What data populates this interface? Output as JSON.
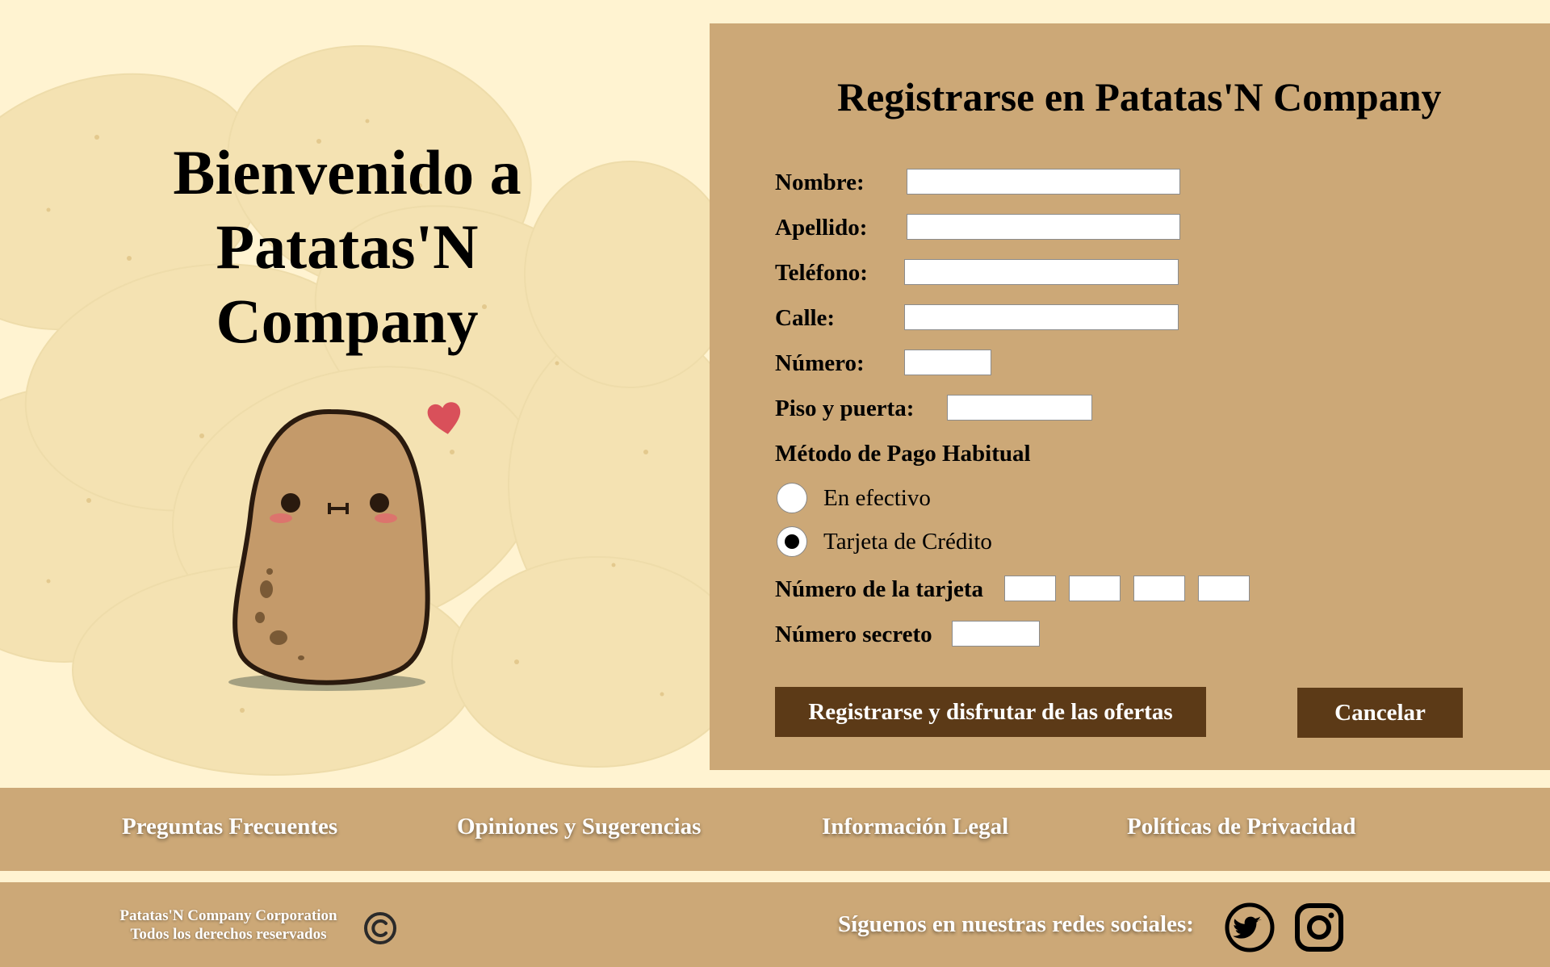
{
  "hero": {
    "welcome_line1": "Bienvenido a",
    "welcome_line2": "Patatas'N",
    "welcome_line3": "Company",
    "mascot_icon": "potato-mascot-icon",
    "heart_icon": "heart-icon"
  },
  "form": {
    "title": "Registrarse en Patatas'N Company",
    "nombre_label": "Nombre:",
    "nombre_value": "",
    "apellido_label": "Apellido:",
    "apellido_value": "",
    "telefono_label": "Teléfono:",
    "telefono_value": "",
    "calle_label": "Calle:",
    "calle_value": "",
    "numero_label": "Número:",
    "numero_value": "",
    "piso_label": "Piso y puerta:",
    "piso_value": "",
    "payment_title": "Método de Pago Habitual",
    "payment_options": [
      {
        "label": "En efectivo",
        "selected": false
      },
      {
        "label": "Tarjeta de Crédito",
        "selected": true
      }
    ],
    "card_label": "Número de la tarjeta",
    "card_values": [
      "",
      "",
      "",
      ""
    ],
    "secret_label": "Número secreto",
    "secret_value": "",
    "submit_label": "Registrarse y disfrutar de las ofertas",
    "cancel_label": "Cancelar"
  },
  "footer_links": [
    "Preguntas Frecuentes",
    "Opiniones y Sugerencias",
    "Información Legal",
    "Políticas de Privacidad"
  ],
  "bottom": {
    "corp_line1": "Patatas'N Company Corporation",
    "corp_line2": "Todos los derechos reservados",
    "copyright_icon": "copyright-icon",
    "follow_text": "Síguenos en nuestras redes sociales:",
    "social_icons": [
      "twitter-icon",
      "instagram-icon"
    ]
  },
  "colors": {
    "page_bg": "#fff3d1",
    "panel_bg": "#cca877",
    "button_bg": "#5c3a17",
    "heart": "#d9505a"
  }
}
